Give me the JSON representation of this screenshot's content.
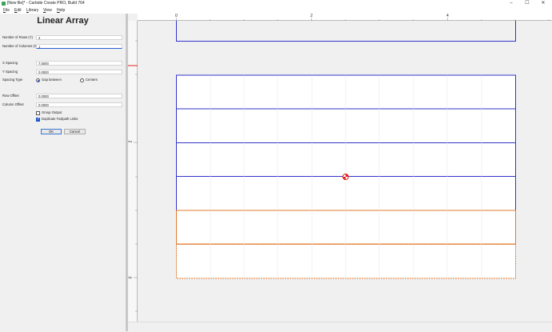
{
  "window": {
    "title": "[New file]* - Carbide Create PRO, Build 764",
    "minimize": "–",
    "maximize": "☐",
    "close": "✕"
  },
  "menu": [
    {
      "label": "File",
      "key": "F",
      "rest": "ile"
    },
    {
      "label": "Edit",
      "key": "E",
      "rest": "dit"
    },
    {
      "label": "Library",
      "key": "L",
      "rest": "ibrary"
    },
    {
      "label": "View",
      "key": "V",
      "rest": "iew"
    },
    {
      "label": "Help",
      "key": "H",
      "rest": "elp"
    }
  ],
  "panel": {
    "title": "Linear Array",
    "rows_label": "Number of Rows (Y)",
    "rows_value": "4",
    "cols_label": "Number of Columns (X)",
    "cols_value": "1",
    "x_spacing_label": "X Spacing",
    "x_spacing_value": "7.5000",
    "y_spacing_label": "Y Spacing",
    "y_spacing_value": "0.0000",
    "spacing_type_label": "Spacing Type",
    "gap_between_label": "Gap between",
    "centers_label": "Centers",
    "spacing_type_selected": "Gap between",
    "row_offset_label": "Row Offset",
    "row_offset_value": "0.0000",
    "col_offset_label": "Column Offset",
    "col_offset_value": "0.0000",
    "group_output_label": "Group Output",
    "group_output_checked": false,
    "dup_toolpath_label": "Duplicate Toolpath Links",
    "dup_toolpath_checked": true,
    "ok_label": "OK",
    "cancel_label": "Cancel"
  },
  "ruler": {
    "top_labels": [
      "0",
      "2",
      "4"
    ],
    "left_labels": [
      "2",
      "0"
    ]
  },
  "colors": {
    "selected_outline": "#3333cc",
    "preview_outline": "#e07a2e",
    "grid": "#e2e2e2",
    "marker": "#e02020"
  }
}
